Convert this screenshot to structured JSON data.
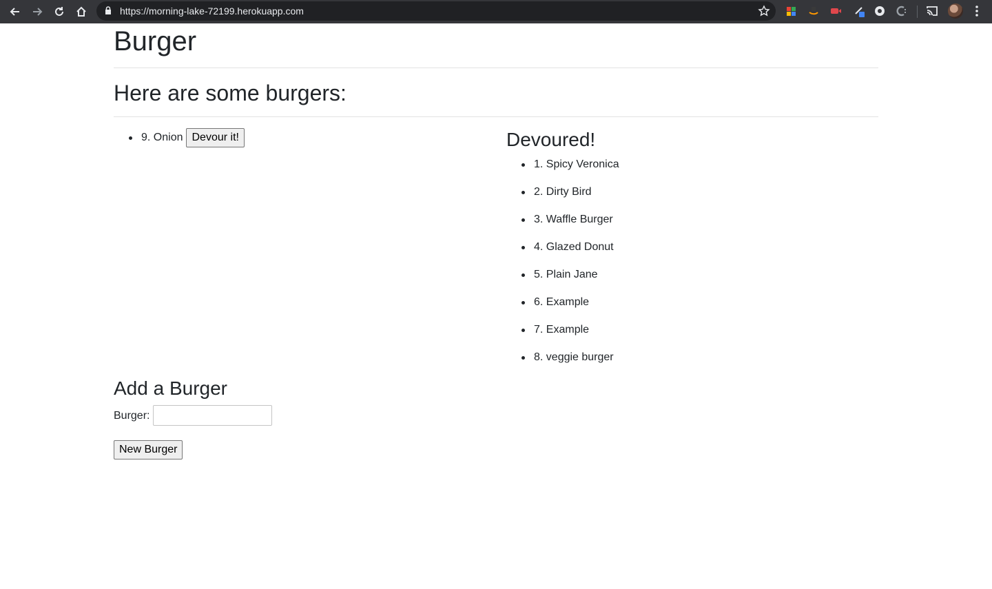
{
  "browser": {
    "url": "https://morning-lake-72199.herokuapp.com"
  },
  "page": {
    "title": "Burger",
    "subtitle": "Here are some burgers:",
    "uneaten": [
      {
        "label": "9. Onion",
        "button": "Devour it!"
      }
    ],
    "devoured_title": "Devoured!",
    "devoured": [
      "1. Spicy Veronica",
      "2. Dirty Bird",
      "3. Waffle Burger",
      "4. Glazed Donut",
      "5. Plain Jane",
      "6. Example",
      "7. Example",
      "8. veggie burger"
    ],
    "add_title": "Add a Burger",
    "form": {
      "label": "Burger:",
      "value": "",
      "submit": "New Burger"
    }
  },
  "colors": {
    "chrome_bg": "#35363a",
    "omnibox_bg": "#202124",
    "text": "#212529"
  }
}
